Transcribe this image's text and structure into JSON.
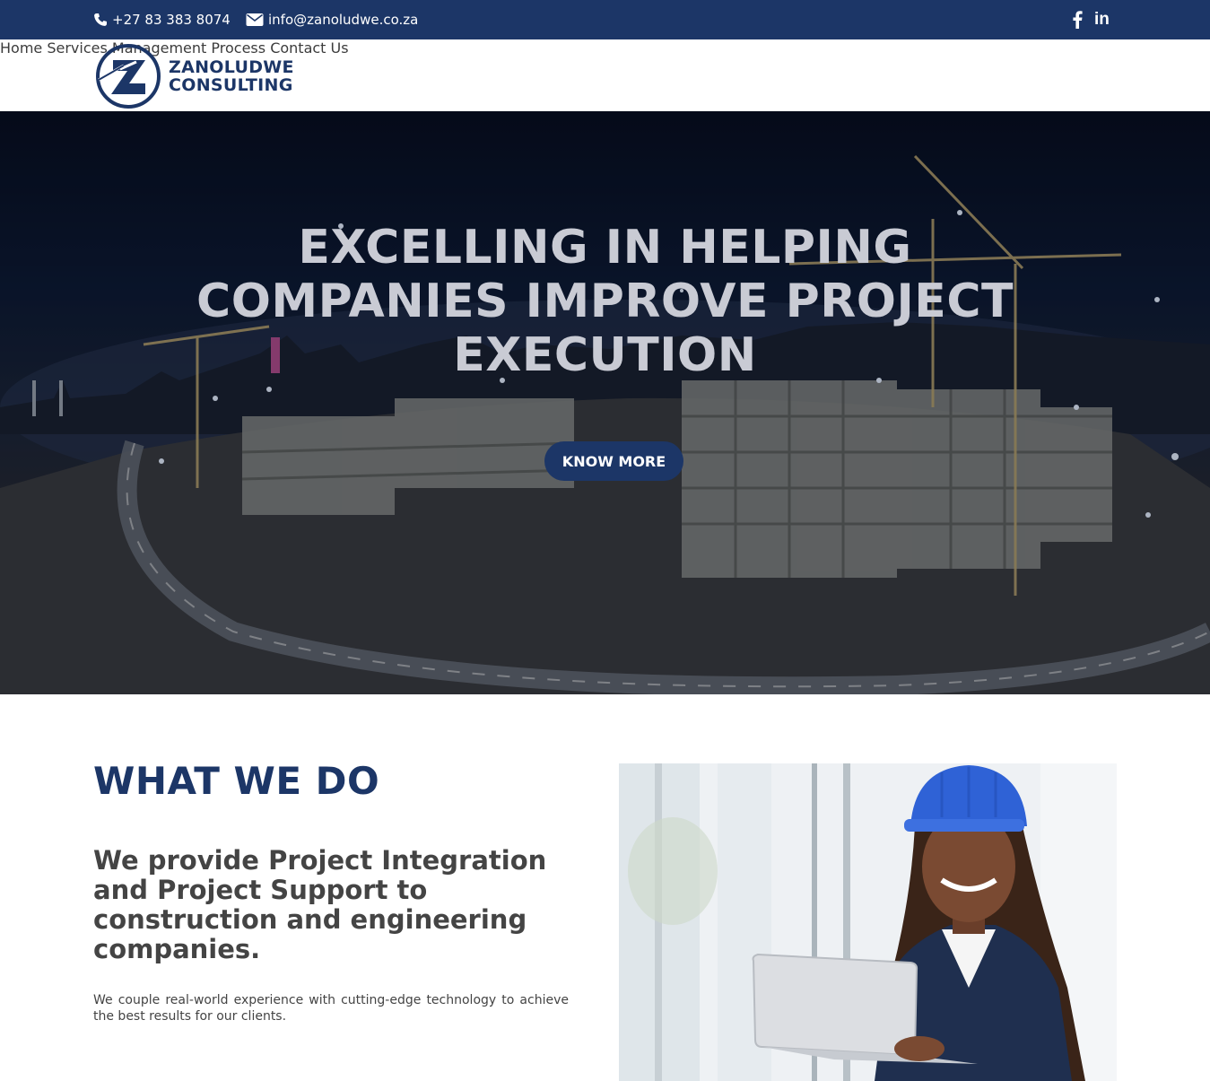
{
  "topbar": {
    "phone": "+27 83 383 8074",
    "email": "info@zanoludwe.co.za",
    "social": [
      "facebook-icon",
      "linkedin-icon"
    ],
    "linkedin_glyph": "in"
  },
  "header": {
    "logo_line1": "ZANOLUDWE",
    "logo_line2": "CONSULTING",
    "nav": [
      "Home",
      "Services",
      "Management",
      "Process",
      "Contact Us"
    ]
  },
  "hero": {
    "title_line1": "EXCELLING IN HELPING",
    "title_line2": "COMPANIES IMPROVE PROJECT",
    "title_line3": "EXECUTION",
    "button_label": "KNOW MORE"
  },
  "what_we_do": {
    "heading": "WHAT WE DO",
    "subheading": "We provide Project Integration and Project Support to construction and engineering companies.",
    "body": "We couple real-world experience with cutting-edge technology to achieve the best results for our clients."
  },
  "colors": {
    "brand_navy": "#1c3667",
    "hero_title": "#c9cbd4",
    "text_dark": "#444444"
  }
}
